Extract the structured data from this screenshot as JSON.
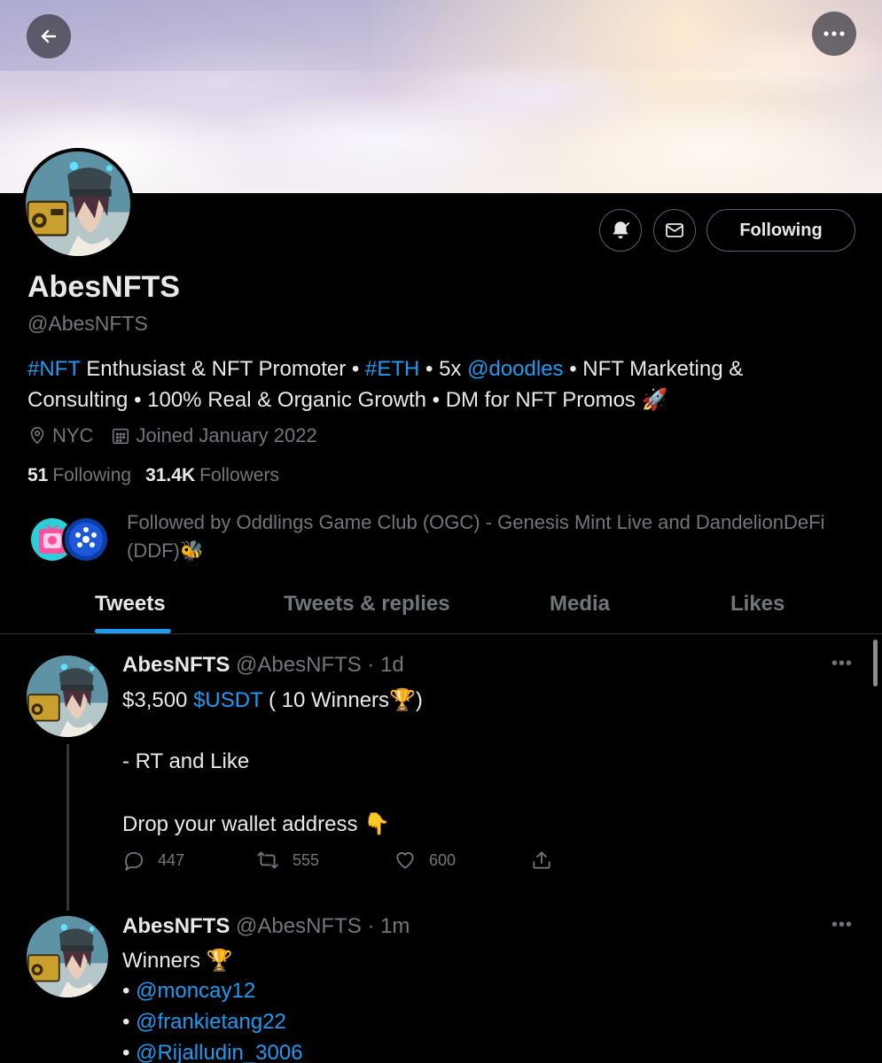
{
  "header": {
    "back_icon": "arrow-left-icon",
    "more_icon": "more-horizontal-icon"
  },
  "profile": {
    "display_name": "AbesNFTS",
    "handle": "@AbesNFTS",
    "follow_button": "Following",
    "bio": {
      "tag_nft": "#NFT",
      "part1": " Enthusiast & NFT Promoter • ",
      "tag_eth": "#ETH",
      "part2": " • 5x ",
      "mention_doodles": "@doodles",
      "part3": " • NFT Marketing & Consulting • 100% Real & Organic Growth • DM for NFT Promos 🚀"
    },
    "location": "NYC",
    "joined": "Joined January 2022",
    "following_count": "51",
    "following_label": "Following",
    "followers_count": "31.4K",
    "followers_label": "Followers",
    "followed_by": "Followed by Oddlings Game Club (OGC) - Genesis Mint Live and DandelionDeFi (DDF)🐝"
  },
  "tabs": [
    {
      "label": "Tweets",
      "active": true
    },
    {
      "label": "Tweets & replies",
      "active": false
    },
    {
      "label": "Media",
      "active": false
    },
    {
      "label": "Likes",
      "active": false
    }
  ],
  "tweets": [
    {
      "name": "AbesNFTS",
      "meta": "@AbesNFTS · 1d",
      "line1_pre": "$3,500 ",
      "line1_link": "$USDT",
      "line1_post": " ( 10 Winners🏆)",
      "line2": "- RT and Like",
      "line3": "Drop your wallet address 👇",
      "replies": "447",
      "retweets": "555",
      "likes": "600"
    },
    {
      "name": "AbesNFTS",
      "meta": "@AbesNFTS · 1m",
      "line1": "Winners 🏆",
      "mentions": [
        "@moncay12",
        "@frankietang22",
        "@Rijalludin_3006"
      ]
    }
  ],
  "colors": {
    "accent": "#1d9bf0",
    "muted": "#71767b",
    "text": "#e7e9ea",
    "background": "#000000",
    "border": "#2f3336"
  }
}
